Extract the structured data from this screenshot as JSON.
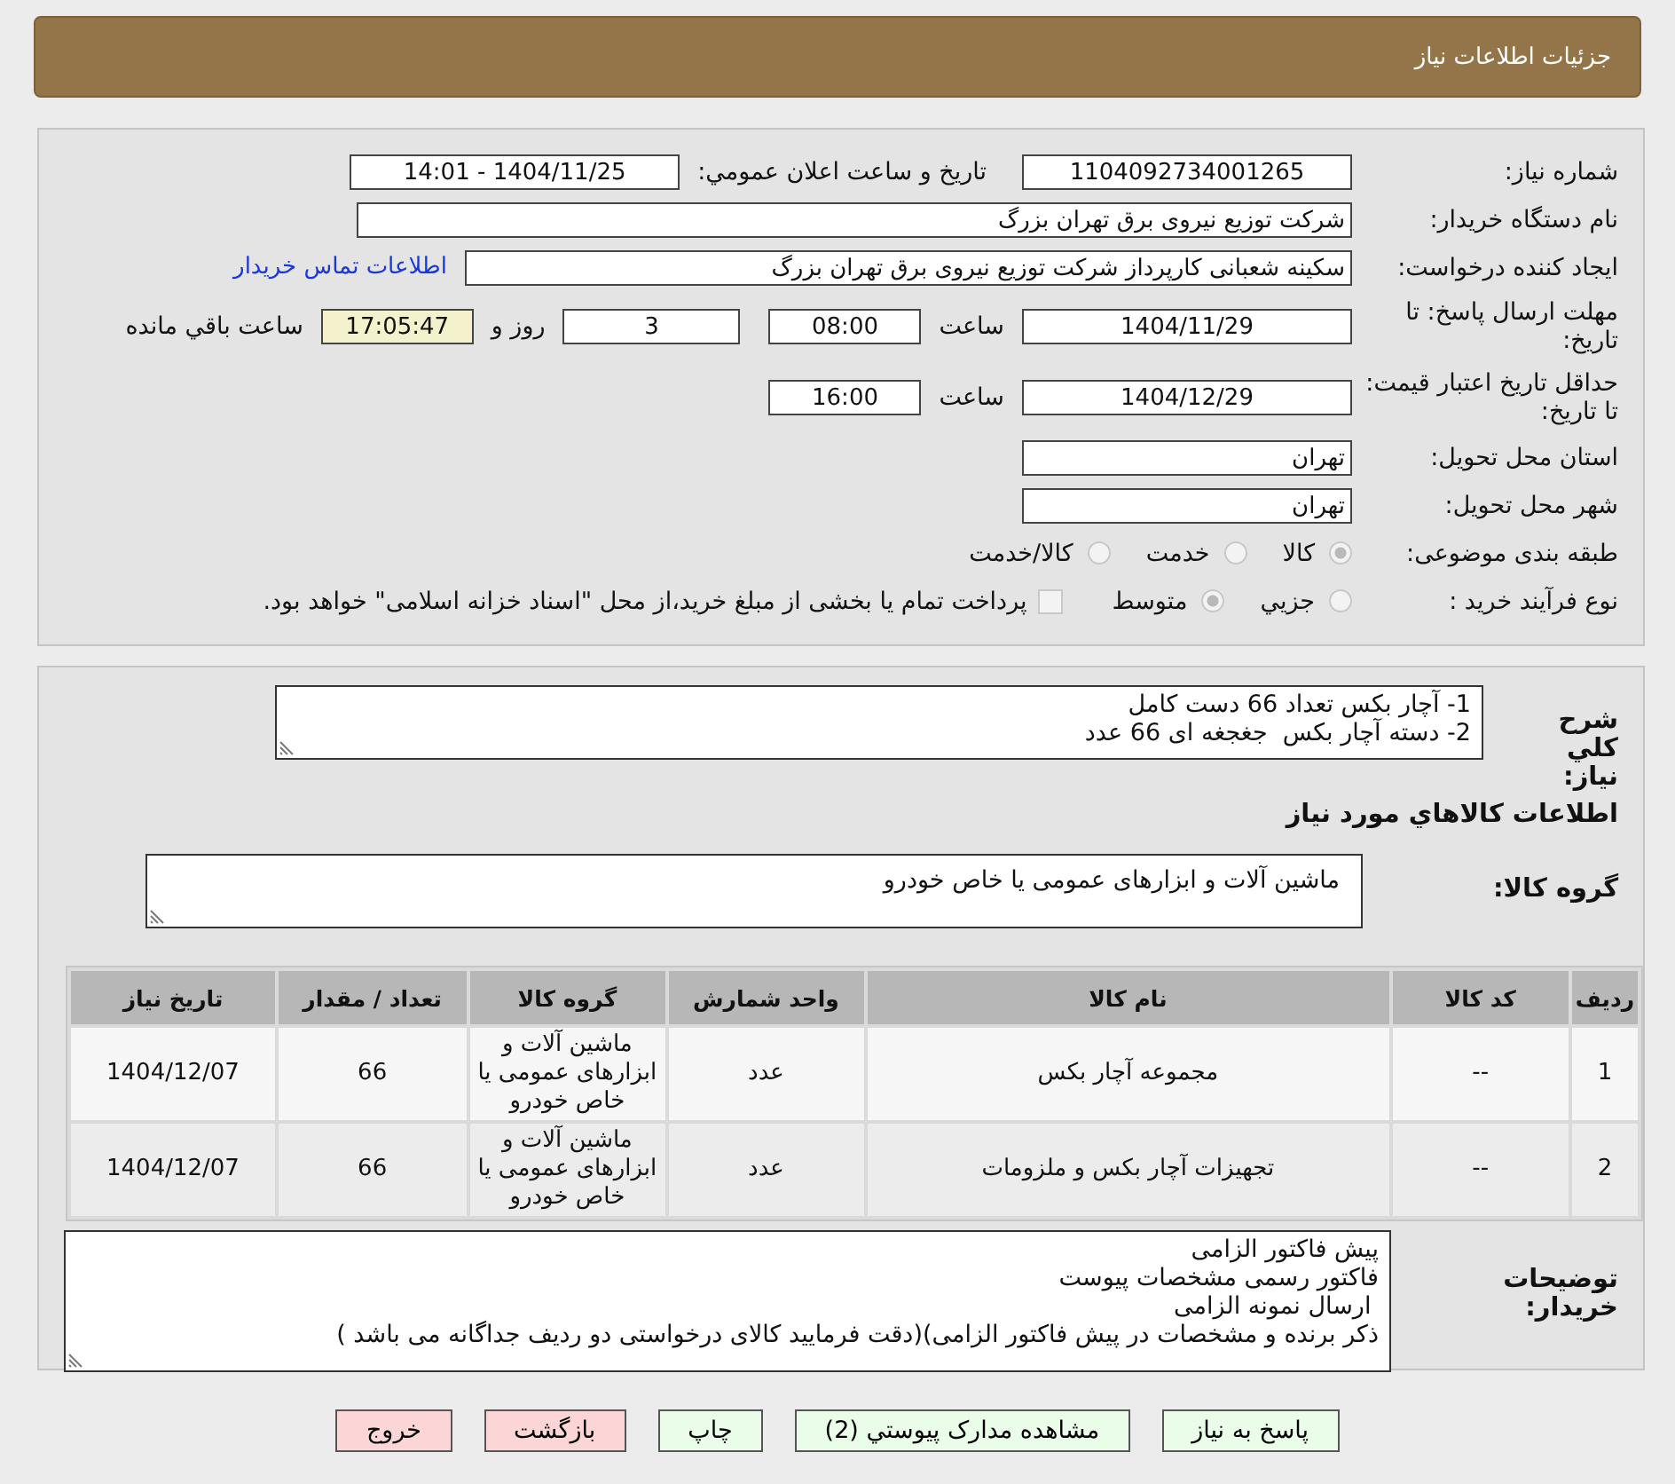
{
  "header": {
    "title": "جزئیات اطلاعات نیاز"
  },
  "need_number": {
    "label": "شماره نیاز:",
    "value": "1104092734001265"
  },
  "announce": {
    "label": "تاريخ و ساعت اعلان عمومي:",
    "value": "1404/11/25 - 14:01"
  },
  "buyer_org": {
    "label": "نام دستگاه خریدار:",
    "value": "شرکت توزیع نیروی برق تهران بزرگ"
  },
  "requester": {
    "label": "ایجاد کننده درخواست:",
    "value": "سکینه شعبانی کارپرداز شرکت توزیع نیروی برق تهران بزرگ",
    "link": "اطلاعات تماس خریدار"
  },
  "reply_deadline": {
    "label": "مهلت ارسال پاسخ: تا تاریخ:",
    "date": "1404/11/29",
    "time_label": "ساعت",
    "time": "08:00",
    "days": "3",
    "days_label": "روز و",
    "remaining": "17:05:47",
    "remaining_label": "ساعت باقي مانده"
  },
  "validity": {
    "label": "حداقل تاریخ اعتبار قیمت: تا تاریخ:",
    "date": "1404/12/29",
    "time_label": "ساعت",
    "time": "16:00"
  },
  "province": {
    "label": "استان محل تحویل:",
    "value": "تهران"
  },
  "city": {
    "label": "شهر محل تحویل:",
    "value": "تهران"
  },
  "category": {
    "label": "طبقه بندی موضوعی:",
    "options": [
      {
        "label": "کالا",
        "selected": true
      },
      {
        "label": "خدمت",
        "selected": false
      },
      {
        "label": "کالا/خدمت",
        "selected": false
      }
    ]
  },
  "process": {
    "label": "نوع فرآیند خرید :",
    "options": [
      {
        "label": "جزيي",
        "selected": false
      },
      {
        "label": "متوسط",
        "selected": true
      }
    ],
    "payment_checked": false,
    "payment_note": "پرداخت تمام یا بخشی از مبلغ خرید،از محل \"اسناد خزانه اسلامی\" خواهد بود."
  },
  "description": {
    "label": "شرح کلي نياز:",
    "lines": [
      "1- آچار بکس تعداد 66 دست کامل",
      "2- دسته آچار بکس  جغجغه ای 66 عدد"
    ]
  },
  "goods_heading": "اطلاعات کالاهاي مورد نياز",
  "goods_group": {
    "label": "گروه کالا:",
    "value": "ماشین آلات و ابزارهای عمومی یا خاص خودرو"
  },
  "table": {
    "columns": [
      "ردیف",
      "کد کالا",
      "نام کالا",
      "واحد شمارش",
      "گروه کالا",
      "تعداد / مقدار",
      "تاریخ نیاز"
    ],
    "rows": [
      [
        "1",
        "--",
        "مجموعه آچار بکس",
        "عدد",
        "ماشین آلات و ابزارهای عمومی یا خاص خودرو",
        "66",
        "1404/12/07"
      ],
      [
        "2",
        "--",
        "تجهیزات آچار بکس و ملزومات",
        "عدد",
        "ماشین آلات و ابزارهای عمومی یا خاص خودرو",
        "66",
        "1404/12/07"
      ]
    ]
  },
  "buyer_notes": {
    "label": "توضیحات خریدار:",
    "lines": [
      "پیش فاکتور الزامی",
      "فاکتور رسمی مشخصات پیوست",
      " ارسال نمونه الزامی",
      "ذکر برنده و مشخصات در پیش فاکتور الزامی)(دقت فرمایید کالای درخواستی دو ردیف جداگانه می باشد )"
    ]
  },
  "buttons": [
    {
      "label": "پاسخ به نیاز",
      "kind": "normal"
    },
    {
      "label": "مشاهده مدارک پیوستي (2)",
      "kind": "normal"
    },
    {
      "label": "چاپ",
      "kind": "normal"
    },
    {
      "label": "بازگشت",
      "kind": "danger"
    },
    {
      "label": "خروج",
      "kind": "danger"
    }
  ]
}
